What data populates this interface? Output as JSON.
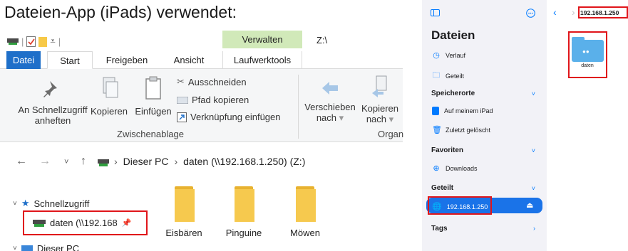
{
  "caption": "Dateien-App (iPads) verwendet:",
  "explorer": {
    "context_tab": "Verwalten",
    "path_title": "Z:\\",
    "tabs": [
      "Datei",
      "Start",
      "Freigeben",
      "Ansicht",
      "Laufwerktools"
    ],
    "ribbon": {
      "pin_label_1": "An Schnellzugriff",
      "pin_label_2": "anheften",
      "copy_label": "Kopieren",
      "paste_label": "Einfügen",
      "cut_label": "Ausschneiden",
      "copy_path_label": "Pfad kopieren",
      "paste_shortcut_label": "Verknüpfung einfügen",
      "clipboard_group": "Zwischenablage",
      "move_to_label_1": "Verschieben",
      "move_to_label_2": "nach",
      "copy_to_label_1": "Kopieren",
      "copy_to_label_2": "nach",
      "organize_group": "Organ"
    },
    "address": {
      "crumb_1": "Dieser PC",
      "crumb_2": "daten (\\\\192.168.1.250) (Z:)"
    },
    "tree": {
      "quick_access": "Schnellzugriff",
      "drive": "daten (\\\\192.168",
      "this_pc": "Dieser PC"
    },
    "folders": [
      "Eisbären",
      "Pinguine",
      "Möwen"
    ]
  },
  "ipad": {
    "title": "Dateien",
    "recent": "Verlauf",
    "shared": "Geteilt",
    "locations_head": "Speicherorte",
    "on_ipad": "Auf meinem iPad",
    "recently_deleted": "Zuletzt gelöscht",
    "favorites_head": "Favoriten",
    "downloads": "Downloads",
    "shared_head": "Geteilt",
    "server": "192.168.1.250",
    "tags_head": "Tags",
    "breadcrumb": "192.168.1.250",
    "folder_name": "daten",
    "accent": "#007aff"
  }
}
